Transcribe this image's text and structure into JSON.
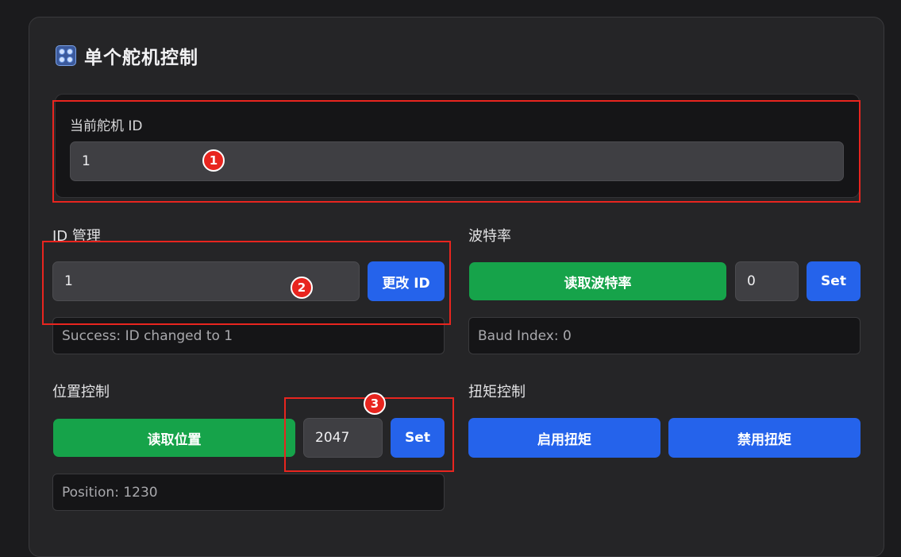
{
  "header": {
    "icon": "servo-icon",
    "title": "单个舵机控制"
  },
  "current_id": {
    "label": "当前舵机 ID",
    "value": "1"
  },
  "id_management": {
    "label": "ID 管理",
    "input_value": "1",
    "button_label": "更改 ID",
    "status": "Success: ID changed to 1"
  },
  "baud": {
    "label": "波特率",
    "read_button": "读取波特率",
    "input_value": "0",
    "set_button": "Set",
    "status": "Baud Index: 0"
  },
  "position": {
    "label": "位置控制",
    "read_button": "读取位置",
    "input_value": "2047",
    "set_button": "Set",
    "status": "Position: 1230"
  },
  "torque": {
    "label": "扭矩控制",
    "enable_button": "启用扭矩",
    "disable_button": "禁用扭矩"
  },
  "annotations": [
    "1",
    "2",
    "3"
  ],
  "colors": {
    "accent_blue": "#2563eb",
    "accent_green": "#16a34a",
    "annotation_red": "#e8251f"
  }
}
